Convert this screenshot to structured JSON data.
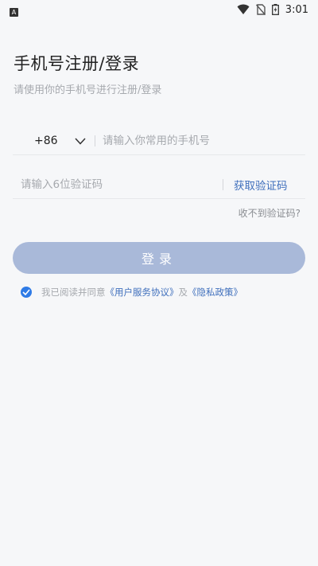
{
  "status_bar": {
    "app_badge": "A",
    "time": "3:01",
    "icons": [
      "wifi-icon",
      "no-sim-icon",
      "battery-icon"
    ]
  },
  "header": {
    "title": "手机号注册/登录",
    "subtitle": "请使用你的手机号进行注册/登录"
  },
  "phone": {
    "country_code": "+86",
    "placeholder": "请输入你常用的手机号",
    "value": ""
  },
  "code": {
    "placeholder": "请输入6位验证码",
    "value": "",
    "get_code_label": "获取验证码"
  },
  "no_code_label": "收不到验证码?",
  "login_button_label": "登录",
  "agreement": {
    "checked": true,
    "prefix": "我已阅读并同意",
    "user_agreement": "《用户服务协议》",
    "conjunction": "及",
    "privacy_policy": "《隐私政策》"
  },
  "colors": {
    "background": "#f6f7f9",
    "accent": "#3f6fbc",
    "button_disabled": "#a9b9d9",
    "checkbox": "#2f7be6"
  }
}
